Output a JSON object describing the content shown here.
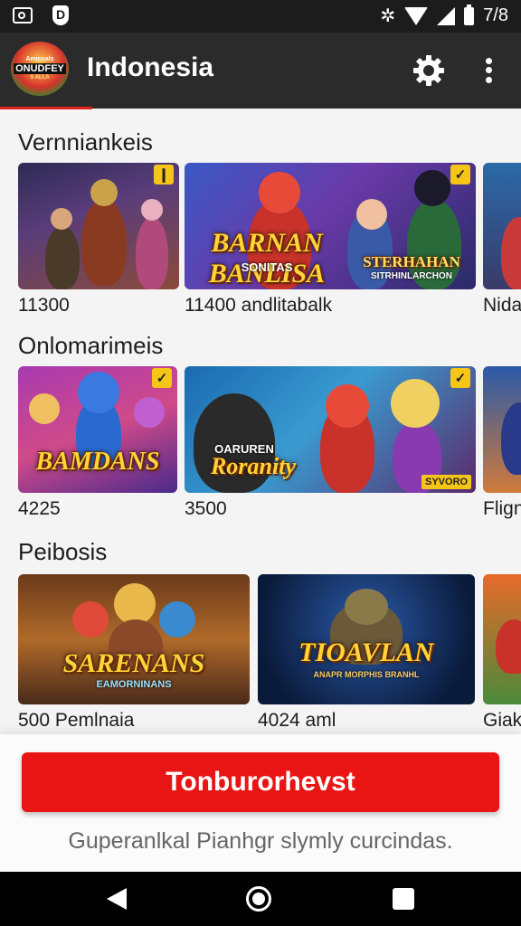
{
  "status_bar": {
    "time": "7/8"
  },
  "app_bar": {
    "logo_lines": [
      "Amicuals",
      "ONUDFEY",
      "S ALLA"
    ],
    "title": "Indonesia"
  },
  "sections": [
    {
      "title": "Vernniankeis",
      "cards": [
        {
          "label": "11300",
          "art_title": "",
          "art_sub": "",
          "badge": "❙"
        },
        {
          "label": "11400 andlitabalk",
          "art_title": "BARNAN BANLISA",
          "art_sub": "SONITAS",
          "badge": "✓",
          "art_title2": "STERHAHAN",
          "art_sub2": "SITRHINLARCHON"
        },
        {
          "label": "Nida",
          "art_title": "",
          "art_sub": "",
          "badge": ""
        }
      ]
    },
    {
      "title": "Onlomarimeis",
      "cards": [
        {
          "label": "4225",
          "art_title": "BAMDANS",
          "art_sub": "",
          "badge": "✓"
        },
        {
          "label": "3500",
          "art_title": "Roranity",
          "art_sub": "OARUREN",
          "badge": "✓",
          "tag": "SYVORO"
        },
        {
          "label": "Flign",
          "art_title": "",
          "art_sub": "",
          "badge": ""
        }
      ]
    },
    {
      "title": "Peibosis",
      "cards": [
        {
          "label": "500 Pemlnaia",
          "art_title": "SARENANS",
          "art_sub": "EAMORNINANS",
          "badge": ""
        },
        {
          "label": "4024 aml",
          "art_title": "TIOAVLAN",
          "art_sub": "ANAPR MORPHIS BRANHL",
          "badge": ""
        },
        {
          "label": "Giak",
          "art_title": "",
          "art_sub": "",
          "badge": ""
        }
      ]
    }
  ],
  "primary_button": "Tonburorhevst",
  "footnote": "Guperanlkal Pianhgr slymly curcindas.",
  "colors": {
    "accent": "#e91515",
    "app_bar": "#2b2b2b",
    "badge": "#f5c518"
  },
  "icons": [
    "photo-icon",
    "shield-icon",
    "vibrate-icon",
    "wifi-icon",
    "signal-icon",
    "battery-icon",
    "gear-icon",
    "more-vert-icon",
    "back-icon",
    "home-icon",
    "recents-icon"
  ]
}
